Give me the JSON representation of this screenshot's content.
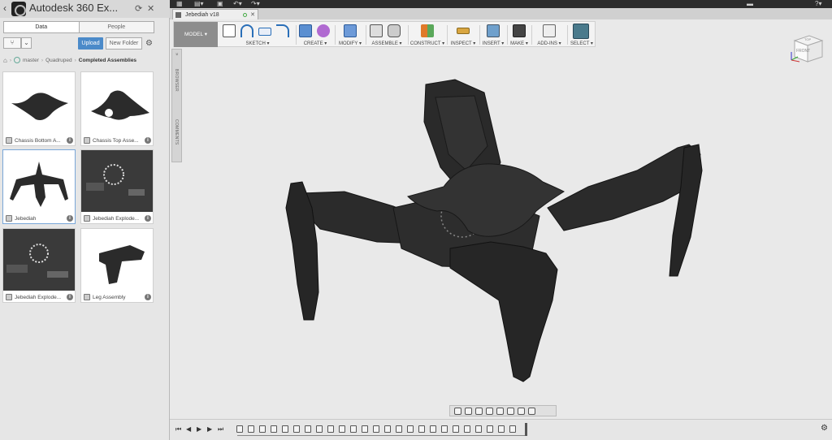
{
  "panel": {
    "title": "Autodesk 360 Ex...",
    "tabs": [
      "Data",
      "People"
    ],
    "upload_label": "Upload",
    "new_folder_label": "New Folder",
    "breadcrumb": [
      "master",
      "Quadruped",
      "Completed Assemblies"
    ],
    "items": [
      {
        "label": "Chassis Bottom A...",
        "thumb": "chassis-bottom"
      },
      {
        "label": "Chassis Top Asse...",
        "thumb": "chassis-top"
      },
      {
        "label": "Jebediah",
        "thumb": "jebediah",
        "selected": true
      },
      {
        "label": "Jebediah Explode...",
        "thumb": "exploded-1"
      },
      {
        "label": "Jebediah Explode...",
        "thumb": "exploded-2"
      },
      {
        "label": "Leg Assembly",
        "thumb": "leg"
      }
    ]
  },
  "document": {
    "tab_label": "Jebediah v18"
  },
  "toolbar": {
    "workspace": "MODEL ▾",
    "groups": [
      "SKETCH ▾",
      "CREATE ▾",
      "MODIFY ▾",
      "ASSEMBLE ▾",
      "CONSTRUCT ▾",
      "INSPECT ▾",
      "INSERT ▾",
      "MAKE ▾",
      "ADD-INS ▾",
      "SELECT ▾"
    ]
  },
  "side_tabs": [
    "BROWSER",
    "COMMENTS"
  ],
  "viewcube": {
    "face": "FRONT",
    "top": "TOP"
  },
  "colors": {
    "accent": "#4b8ac9",
    "model": "#2b2b2b",
    "select_active": "#4a7a8c"
  }
}
